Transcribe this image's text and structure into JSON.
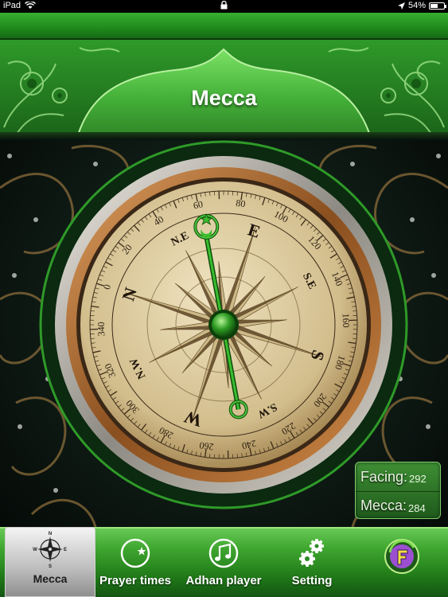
{
  "status_bar": {
    "device": "iPad",
    "battery": "54%",
    "battery_level": 0.54
  },
  "header": {
    "title": "Mecca"
  },
  "compass": {
    "heading_deg": 292,
    "degree_labels": [
      "20",
      "40",
      "60",
      "80",
      "100",
      "120",
      "140",
      "160",
      "180",
      "200",
      "220",
      "240",
      "260",
      "280",
      "300",
      "320",
      "340",
      "0"
    ],
    "cardinal_labels": [
      "N",
      "E",
      "S",
      "W"
    ],
    "intercardinal_labels": [
      "N.E",
      "S.E",
      "S.W",
      "N.W"
    ]
  },
  "readouts": {
    "facing_label": "Facing:",
    "facing_value": "292",
    "mecca_label": "Mecca:",
    "mecca_value": "284"
  },
  "tabbar": {
    "tabs": [
      {
        "label": "Mecca",
        "icon": "compass-rose-icon"
      },
      {
        "label": "Prayer times",
        "icon": "crescent-star-icon"
      },
      {
        "label": "Adhan player",
        "icon": "music-note-icon"
      },
      {
        "label": "Setting",
        "icon": "gears-icon"
      },
      {
        "label": "",
        "icon": "app-logo-icon"
      }
    ],
    "compass_icon_letters": [
      "N",
      "E",
      "S",
      "W"
    ]
  },
  "colors": {
    "accent_green": "#3ea52f",
    "dark_green": "#145512",
    "brass": "#b47a3a",
    "dial_face": "#d6c49a"
  }
}
